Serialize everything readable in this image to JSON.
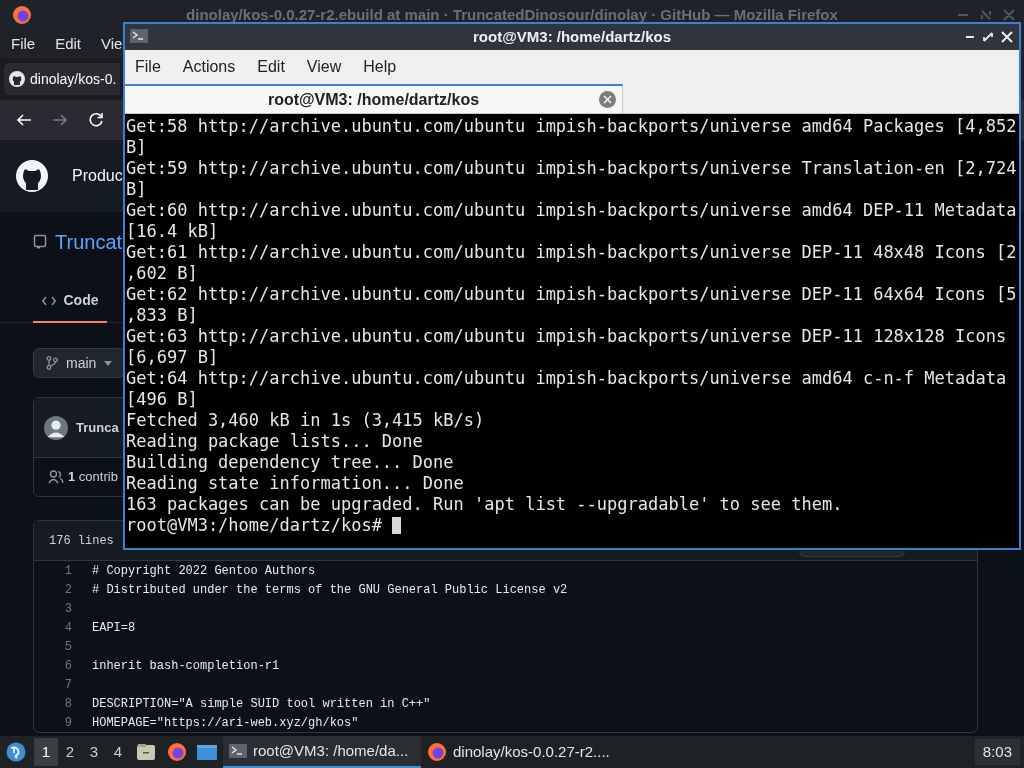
{
  "browser": {
    "title": "dinolay/kos-0.0.27-r2.ebuild at main · TruncatedDinosour/dinolay · GitHub — Mozilla Firefox",
    "menu": [
      "File",
      "Edit",
      "Vie"
    ],
    "tab": {
      "title": "dinolay/kos-0."
    },
    "github": {
      "nav_text": "Produc",
      "repo": "Truncat",
      "tabs": [
        {
          "label": "Code",
          "selected": true
        }
      ],
      "branch": "main",
      "commit_author": "Trunca",
      "contributors": "**1** contrib",
      "file_info": "176 lines",
      "code_lines": [
        {
          "number": "1",
          "text": "# Copyright 2022 Gentoo Authors"
        },
        {
          "number": "2",
          "text": "# Distributed under the terms of the GNU General Public License v2"
        },
        {
          "number": "3"
        },
        {
          "number": "4",
          "text": "EAPI=8"
        },
        {
          "number": "5"
        },
        {
          "number": "6",
          "text": "inherit bash-completion-r1"
        },
        {
          "number": "7"
        },
        {
          "number": "8",
          "text": "DESCRIPTION=\"A simple SUID tool written in C++\""
        },
        {
          "number": "9",
          "text": "HOMEPAGE=\"https://ari-web.xyz/gh/kos\""
        }
      ]
    }
  },
  "terminal": {
    "title": "root@VM3: /home/dartz/kos",
    "menu": [
      "File",
      "Actions",
      "Edit",
      "View",
      "Help"
    ],
    "tab": {
      "title": "root@VM3: /home/dartz/kos"
    },
    "lines": [
      "Get:58 http://archive.ubuntu.com/ubuntu impish-backports/universe amd64 Packages [4,852",
      "B]",
      "Get:59 http://archive.ubuntu.com/ubuntu impish-backports/universe Translation-en [2,724",
      "B]",
      "Get:60 http://archive.ubuntu.com/ubuntu impish-backports/universe amd64 DEP-11 Metadata",
      "[16.4 kB]",
      "Get:61 http://archive.ubuntu.com/ubuntu impish-backports/universe DEP-11 48x48 Icons [2",
      ",602 B]",
      "Get:62 http://archive.ubuntu.com/ubuntu impish-backports/universe DEP-11 64x64 Icons [5",
      ",833 B]",
      "Get:63 http://archive.ubuntu.com/ubuntu impish-backports/universe DEP-11 128x128 Icons",
      "[6,697 B]",
      "Get:64 http://archive.ubuntu.com/ubuntu impish-backports/universe amd64 c-n-f Metadata",
      "[496 B]",
      "Fetched 3,460 kB in 1s (3,415 kB/s)",
      "Reading package lists... Done",
      "Building dependency tree... Done",
      "Reading state information... Done",
      "163 packages can be upgraded. Run 'apt list --upgradable' to see them."
    ],
    "prompt": "root@VM3:/home/dartz/kos# "
  },
  "taskbar": {
    "workspaces": [
      {
        "label": "1",
        "selected": true
      },
      {
        "label": "2",
        "selected": false
      },
      {
        "label": "3",
        "selected": false
      },
      {
        "label": "4",
        "selected": false
      }
    ],
    "tasks": [
      {
        "kind": "terminal",
        "label": "root@VM3: /home/da...",
        "selected": true
      },
      {
        "kind": "browser",
        "label": "dinolay/kos-0.0.27-r2....",
        "selected": false
      }
    ],
    "clock": "8:03"
  }
}
